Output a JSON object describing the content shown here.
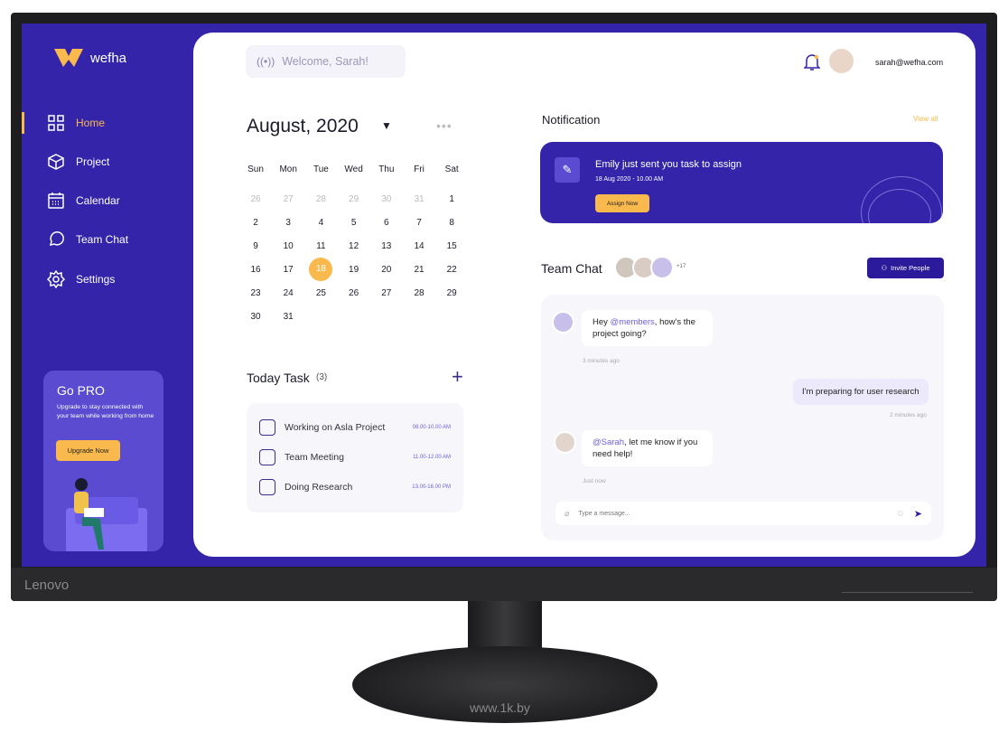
{
  "app": {
    "name": "wefha",
    "accent": "#f9b94c",
    "primary": "#3424a9"
  },
  "sidebar": {
    "items": [
      {
        "label": "Home",
        "icon": "grid-icon",
        "active": true
      },
      {
        "label": "Project",
        "icon": "cube-icon"
      },
      {
        "label": "Calendar",
        "icon": "calendar-icon"
      },
      {
        "label": "Team Chat",
        "icon": "chat-icon"
      },
      {
        "label": "Settings",
        "icon": "gear-icon"
      }
    ]
  },
  "promo": {
    "title": "Go PRO",
    "text": "Upgrade to stay connected with your team while working from home",
    "button": "Upgrade Now"
  },
  "header": {
    "welcome": "Welcome, Sarah!",
    "email": "sarah@wefha.com"
  },
  "calendar": {
    "title": "August, 2020",
    "weekdays": [
      "Sun",
      "Mon",
      "Tue",
      "Wed",
      "Thu",
      "Fri",
      "Sat"
    ],
    "weeks": [
      [
        "26",
        "27",
        "28",
        "29",
        "30",
        "31",
        "1"
      ],
      [
        "2",
        "3",
        "4",
        "5",
        "6",
        "7",
        "8"
      ],
      [
        "9",
        "10",
        "11",
        "12",
        "13",
        "14",
        "15"
      ],
      [
        "16",
        "17",
        "18",
        "19",
        "20",
        "21",
        "22"
      ],
      [
        "23",
        "24",
        "25",
        "26",
        "27",
        "28",
        "29"
      ],
      [
        "30",
        "31"
      ]
    ],
    "selected": "18"
  },
  "tasks": {
    "title": "Today Task",
    "count": "3",
    "items": [
      {
        "label": "Working on Asla Project",
        "time": "08.00-10.00 AM"
      },
      {
        "label": "Team Meeting",
        "time": "11.00-12.00 AM"
      },
      {
        "label": "Doing Research",
        "time": "13.00-16.00 PM"
      }
    ]
  },
  "notification": {
    "title": "Notification",
    "view_all": "View all",
    "message": "Emily just sent you task to assign",
    "time": "18 Aug 2020 - 10.00 AM",
    "button": "Assign Now"
  },
  "chat": {
    "title": "Team Chat",
    "extra_members": "+17",
    "invite": "Invite People",
    "messages": [
      {
        "mention": "@members",
        "text": ", how's the project going?",
        "pre": "Hey ",
        "time": "3 minutes ago"
      },
      {
        "text": "I'm preparing for user research",
        "time": "2 minutes ago"
      },
      {
        "mention": "@Sarah",
        "text": ", let me know if you need help!",
        "time": "Just now"
      }
    ],
    "placeholder": "Type a message..."
  },
  "monitor": {
    "brand": "Lenovo",
    "watermark": "www.1k.by"
  }
}
